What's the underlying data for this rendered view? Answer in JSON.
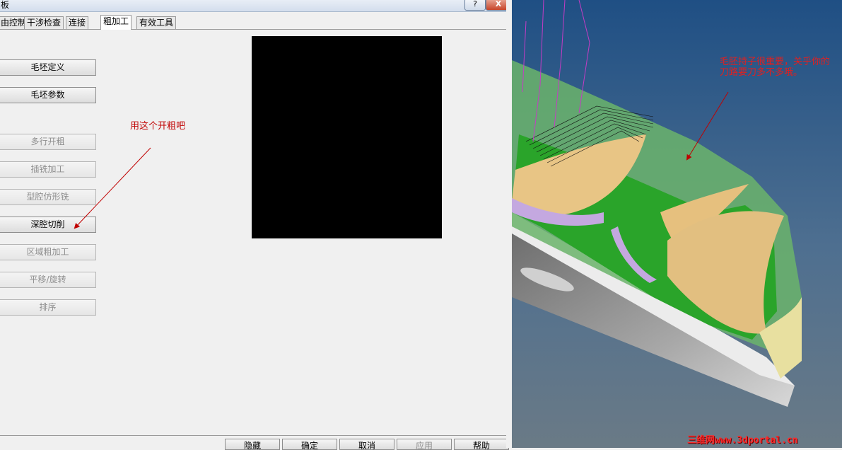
{
  "dialog": {
    "title": "板",
    "help_btn": "?",
    "close_btn": "X",
    "tabs": [
      "由控制",
      "干涉检查",
      "连接",
      "粗加工",
      "有效工具"
    ],
    "buttons": [
      {
        "label": "毛坯定义",
        "enabled": true
      },
      {
        "label": "毛坯参数",
        "enabled": true
      },
      {
        "label": "多行开粗",
        "enabled": false
      },
      {
        "label": "插铣加工",
        "enabled": false
      },
      {
        "label": "型腔仿形铣",
        "enabled": false
      },
      {
        "label": "深腔切削",
        "enabled": true
      },
      {
        "label": "区域粗加工",
        "enabled": false
      },
      {
        "label": "平移/旋转",
        "enabled": false
      },
      {
        "label": "排序",
        "enabled": false
      }
    ],
    "annotation": "用这个开粗吧",
    "bottom_buttons": [
      {
        "label": "隐藏",
        "enabled": true
      },
      {
        "label": "确定",
        "enabled": true
      },
      {
        "label": "取消",
        "enabled": true
      },
      {
        "label": "应用",
        "enabled": false
      },
      {
        "label": "帮助",
        "enabled": true
      }
    ]
  },
  "viewport": {
    "note": "毛胚持子很重要，关乎你的刀路要刀多不多哦。",
    "watermark": "三维网www.3dportal.cn"
  },
  "colors": {
    "annotation": "#c00000",
    "note": "#e02020",
    "bg": "#f0f0f0"
  }
}
